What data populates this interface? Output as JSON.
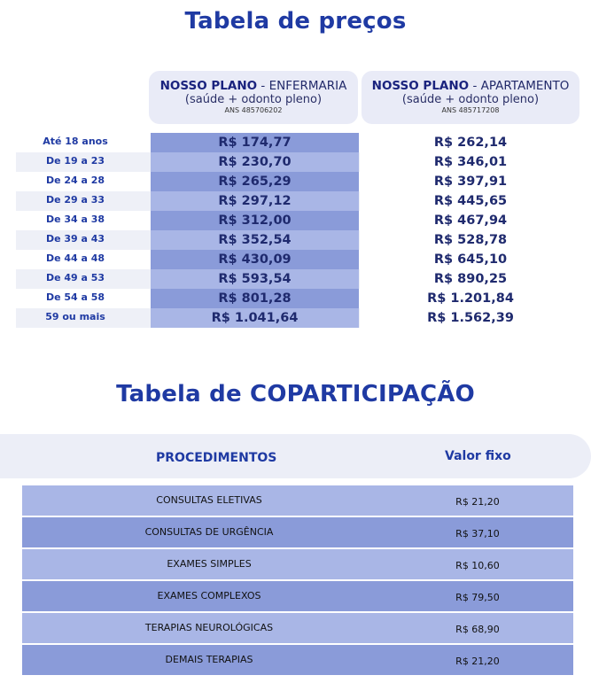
{
  "price_table": {
    "title": "Tabela de preços",
    "plans": [
      {
        "name": "NOSSO PLANO",
        "type": " - ENFERMARIA",
        "subtitle": "(saúde + odonto pleno)",
        "ans": "ANS 485706202"
      },
      {
        "name": "NOSSO PLANO",
        "type": " - APARTAMENTO",
        "subtitle": "(saúde + odonto pleno)",
        "ans": "ANS 485717208"
      }
    ],
    "rows": [
      {
        "age": "Até 18 anos",
        "enfermaria": "R$ 174,77",
        "apartamento": "R$ 262,14"
      },
      {
        "age": "De  19  a  23",
        "enfermaria": "R$ 230,70",
        "apartamento": "R$ 346,01"
      },
      {
        "age": "De  24  a  28",
        "enfermaria": "R$ 265,29",
        "apartamento": "R$ 397,91"
      },
      {
        "age": "De  29  a  33",
        "enfermaria": "R$ 297,12",
        "apartamento": "R$ 445,65"
      },
      {
        "age": "De  34  a  38",
        "enfermaria": "R$ 312,00",
        "apartamento": "R$ 467,94"
      },
      {
        "age": "De  39  a  43",
        "enfermaria": "R$ 352,54",
        "apartamento": "R$ 528,78"
      },
      {
        "age": "De  44  a  48",
        "enfermaria": "R$ 430,09",
        "apartamento": "R$ 645,10"
      },
      {
        "age": "De  49  a  53",
        "enfermaria": "R$ 593,54",
        "apartamento": "R$ 890,25"
      },
      {
        "age": "De  54  a  58",
        "enfermaria": "R$ 801,28",
        "apartamento": "R$ 1.201,84"
      },
      {
        "age": "59 ou mais",
        "enfermaria": "R$ 1.041,64",
        "apartamento": "R$ 1.562,39"
      }
    ]
  },
  "copart_table": {
    "title": "Tabela de COPARTICIPAÇÃO",
    "header": {
      "procedures": "PROCEDIMENTOS",
      "value": "Valor fixo"
    },
    "rows": [
      {
        "procedure": "CONSULTAS ELETIVAS",
        "value": "R$ 21,20"
      },
      {
        "procedure": "CONSULTAS DE URGÊNCIA",
        "value": "R$ 37,10"
      },
      {
        "procedure": "EXAMES SIMPLES",
        "value": "R$ 10,60"
      },
      {
        "procedure": "EXAMES COMPLEXOS",
        "value": "R$ 79,50"
      },
      {
        "procedure": "TERAPIAS NEUROLÓGICAS",
        "value": "R$ 68,90"
      },
      {
        "procedure": "DEMAIS TERAPIAS",
        "value": "R$ 21,20"
      }
    ]
  },
  "colors": {
    "title": "#1f3aa3",
    "cell_dark": "#8a9bd9",
    "cell_light": "#a9b6e6",
    "header_bg": "#e9ebf7"
  }
}
